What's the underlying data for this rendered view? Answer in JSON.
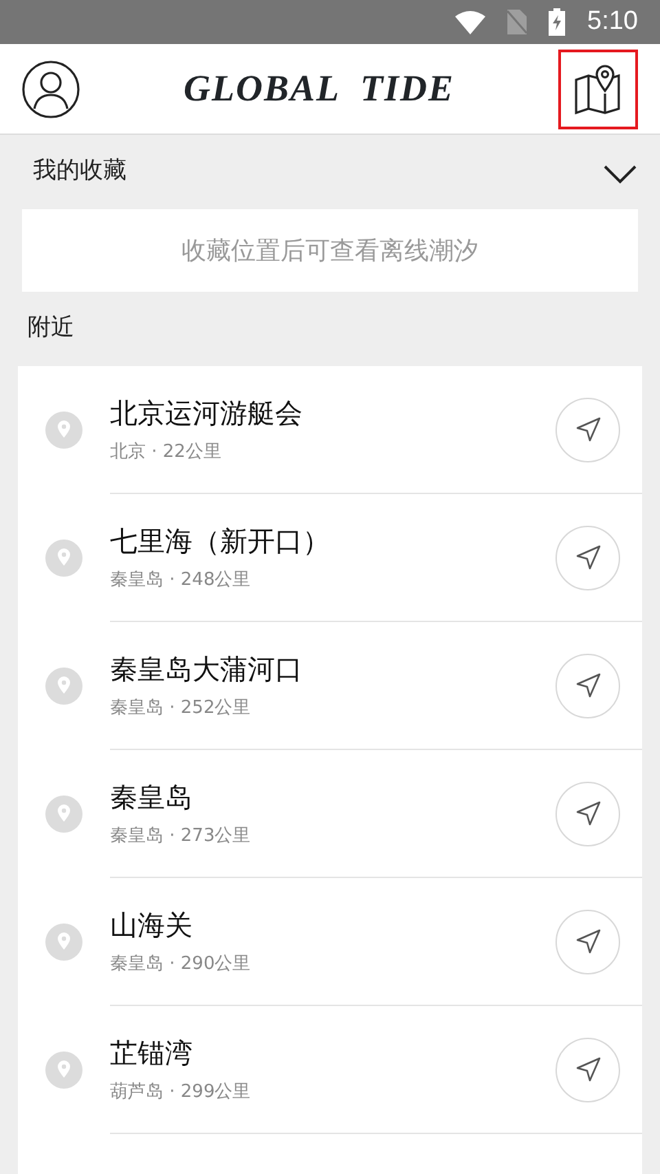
{
  "status_bar": {
    "time": "5:10"
  },
  "header": {
    "logo": "GLOBAL  TIDE",
    "map_button_highlighted": true
  },
  "favorites": {
    "title": "我的收藏",
    "expanded": true,
    "empty_text": "收藏位置后可查看离线潮汐"
  },
  "nearby": {
    "title": "附近",
    "items": [
      {
        "name": "北京运河游艇会",
        "detail": "北京 · 22公里"
      },
      {
        "name": "七里海（新开口）",
        "detail": "秦皇岛 · 248公里"
      },
      {
        "name": "秦皇岛大蒲河口",
        "detail": "秦皇岛 · 252公里"
      },
      {
        "name": "秦皇岛",
        "detail": "秦皇岛 · 273公里"
      },
      {
        "name": "山海关",
        "detail": "秦皇岛 · 290公里"
      },
      {
        "name": "芷锚湾",
        "detail": "葫芦岛 · 299公里"
      }
    ]
  }
}
